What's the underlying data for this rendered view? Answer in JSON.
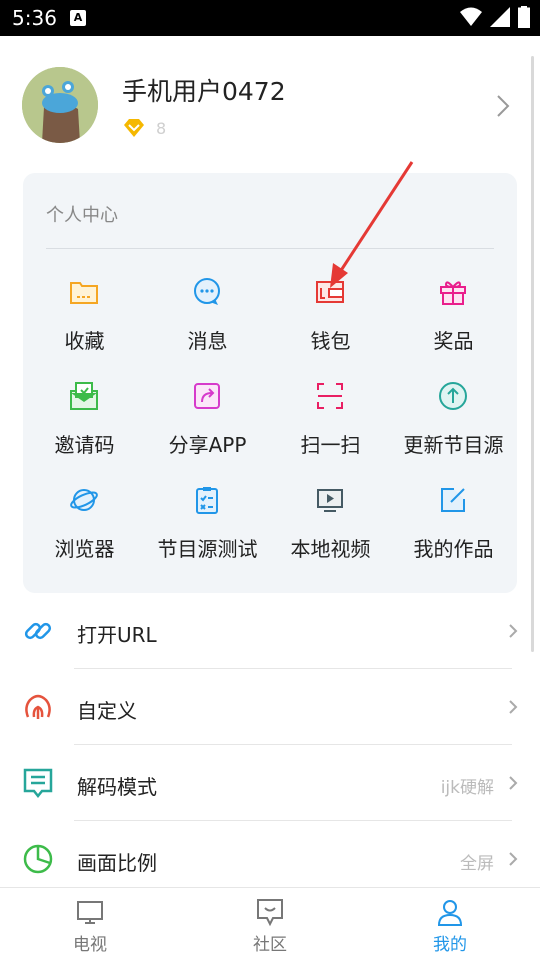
{
  "status_bar": {
    "time": "5:36",
    "a_icon": "A"
  },
  "profile": {
    "username": "手机用户0472",
    "vip_level": "8"
  },
  "personal_center": {
    "title": "个人中心",
    "items": [
      {
        "label": "收藏",
        "icon": "folder-icon",
        "color": "#f5a623"
      },
      {
        "label": "消息",
        "icon": "chat-bubble-icon",
        "color": "#2196e8"
      },
      {
        "label": "钱包",
        "icon": "wallet-icon",
        "color": "#e53935"
      },
      {
        "label": "奖品",
        "icon": "gift-icon",
        "color": "#e91e8c"
      },
      {
        "label": "邀请码",
        "icon": "envelope-icon",
        "color": "#3dbb4a"
      },
      {
        "label": "分享APP",
        "icon": "share-icon",
        "color": "#d63acb"
      },
      {
        "label": "扫一扫",
        "icon": "scan-icon",
        "color": "#e91e63"
      },
      {
        "label": "更新节目源",
        "icon": "upload-circle-icon",
        "color": "#26a69a"
      },
      {
        "label": "浏览器",
        "icon": "planet-icon",
        "color": "#2196e8"
      },
      {
        "label": "节目源测试",
        "icon": "clipboard-check-icon",
        "color": "#2196e8"
      },
      {
        "label": "本地视频",
        "icon": "video-screen-icon",
        "color": "#455a64"
      },
      {
        "label": "我的作品",
        "icon": "edit-square-icon",
        "color": "#2196e8"
      }
    ]
  },
  "settings": [
    {
      "label": "打开URL",
      "value": "",
      "icon": "link-icon",
      "color": "#2196e8"
    },
    {
      "label": "自定义",
      "value": "",
      "icon": "custom-icon",
      "color": "#e5533d"
    },
    {
      "label": "解码模式",
      "value": "ijk硬解",
      "icon": "decode-icon",
      "color": "#26a69a"
    },
    {
      "label": "画面比例",
      "value": "全屏",
      "icon": "pie-chart-icon",
      "color": "#3dbb4a"
    }
  ],
  "tabs": [
    {
      "label": "电视",
      "icon": "tv-icon",
      "active": false
    },
    {
      "label": "社区",
      "icon": "community-icon",
      "active": false
    },
    {
      "label": "我的",
      "icon": "person-icon",
      "active": true
    }
  ],
  "colors": {
    "accent": "#2196e8",
    "annotation_arrow": "#e53935",
    "vip": "#f5b800"
  }
}
